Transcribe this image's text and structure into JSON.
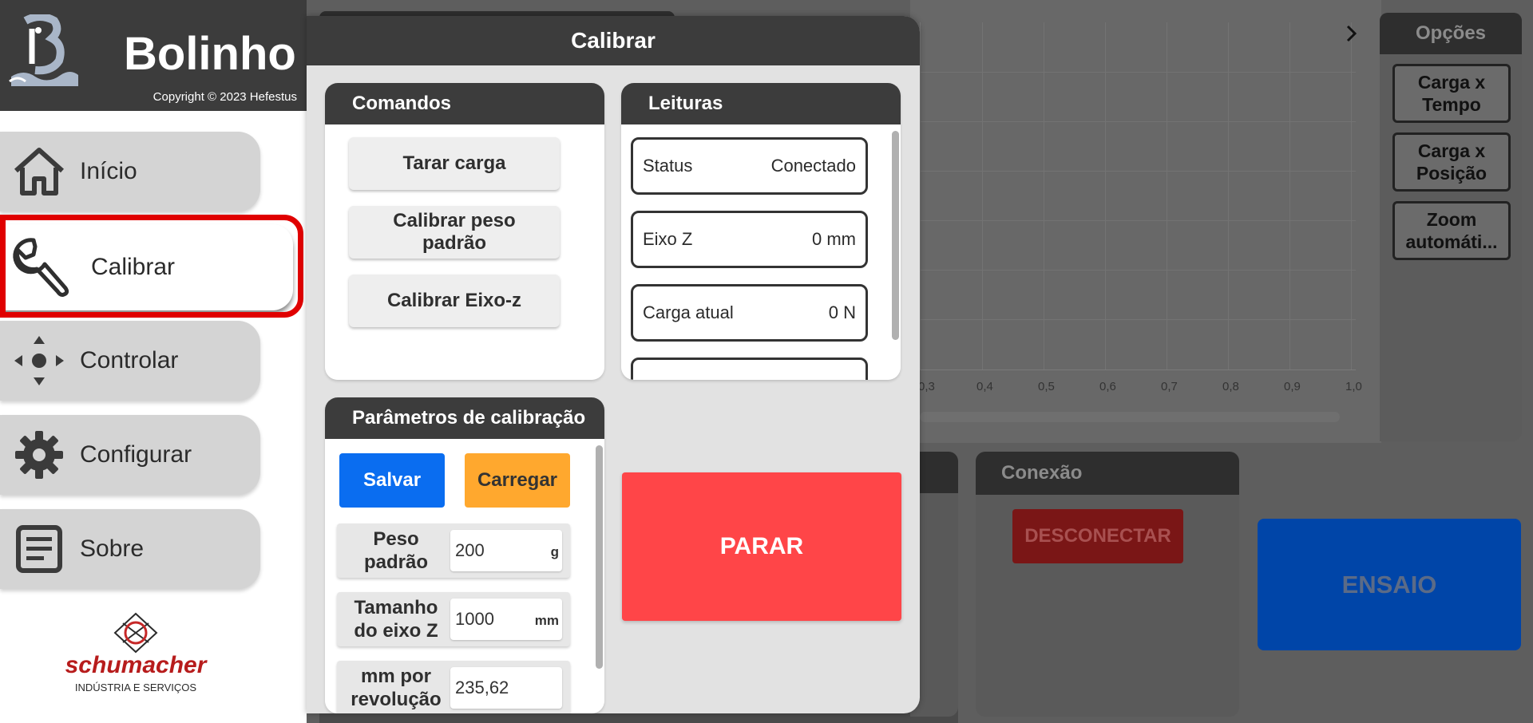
{
  "sidebar": {
    "app_title": "Bolinho",
    "copyright": "Copyright © 2023 Hefestus",
    "items": [
      {
        "label": "Início",
        "icon": "home-icon"
      },
      {
        "label": "Calibrar",
        "icon": "wrench-icon",
        "active": true
      },
      {
        "label": "Controlar",
        "icon": "move-arrows-icon"
      },
      {
        "label": "Configurar",
        "icon": "gear-icon"
      },
      {
        "label": "Sobre",
        "icon": "document-icon"
      }
    ],
    "footer_logo": {
      "name": "schumacher",
      "tagline": "INDÚSTRIA E SERVIÇOS"
    }
  },
  "background": {
    "chart_ticks": [
      "0,3",
      "0,4",
      "0,5",
      "0,6",
      "0,7",
      "0,8",
      "0,9",
      "1,0"
    ],
    "options_title": "Opções",
    "options": [
      "Carga x Tempo",
      "Carga x Posição",
      "Zoom automáti..."
    ],
    "connection_title": "Conexão",
    "disconnect_label": "DESCONECTAR",
    "test_label": "ENSAIO"
  },
  "modal": {
    "title": "Calibrar",
    "commands": {
      "title": "Comandos",
      "buttons": [
        "Tarar carga",
        "Calibrar peso padrão",
        "Calibrar Eixo-z"
      ]
    },
    "readings": {
      "title": "Leituras",
      "items": [
        {
          "label": "Status",
          "value": "Conectado"
        },
        {
          "label": "Eixo Z",
          "value": "0 mm"
        },
        {
          "label": "Carga atual",
          "value": "0 N"
        }
      ]
    },
    "params": {
      "title": "Parâmetros de calibração",
      "save_label": "Salvar",
      "load_label": "Carregar",
      "fields": [
        {
          "label": "Peso padrão",
          "value": "200",
          "unit": "g"
        },
        {
          "label": "Tamanho do eixo Z",
          "value": "1000",
          "unit": "mm"
        },
        {
          "label": "mm por revolução",
          "value": "235,62",
          "unit": ""
        }
      ]
    },
    "stop_label": "PARAR"
  },
  "colors": {
    "header_dark": "#3c3c3c",
    "save_blue": "#0a6df0",
    "load_orange": "#ffa82e",
    "stop_red": "#ff4548",
    "highlight_red": "#e00000"
  }
}
